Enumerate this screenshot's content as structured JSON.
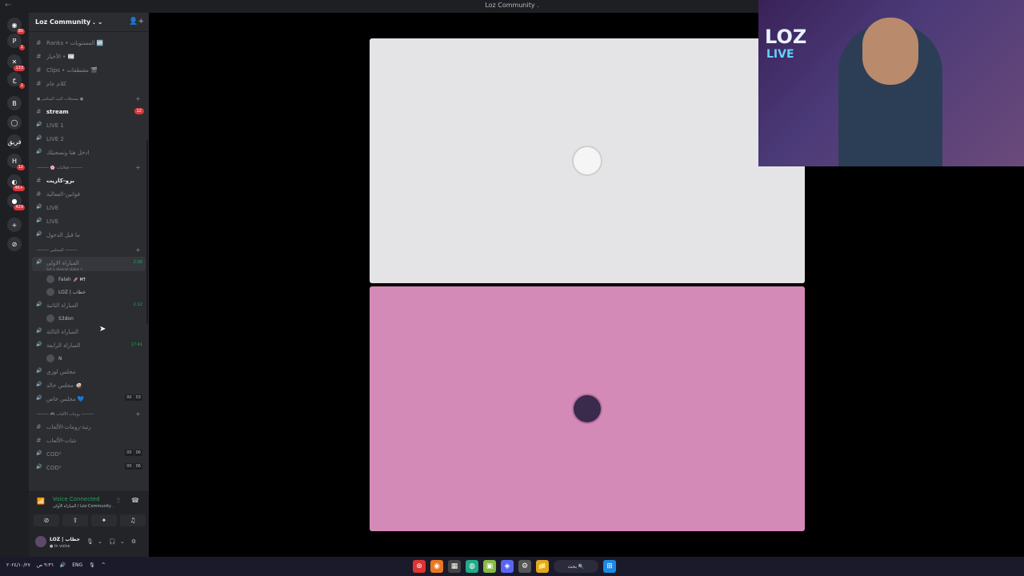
{
  "window": {
    "title": "Loz Community .",
    "back_icon": "arrow-left-icon"
  },
  "servers": [
    {
      "icon": "discord-icon",
      "glyph": "◉",
      "badge": "80"
    },
    {
      "icon": "server-p",
      "glyph": "P",
      "badge": "1"
    },
    {
      "icon": "server-b",
      "glyph": "✕",
      "badge": "133"
    },
    {
      "icon": "server-arabic",
      "glyph": "ج",
      "badge": "1"
    },
    {
      "icon": "server-blue",
      "glyph": "B",
      "badge": ""
    },
    {
      "icon": "server-ring",
      "glyph": "◯",
      "badge": ""
    },
    {
      "icon": "server-text",
      "glyph": "فريق",
      "badge": ""
    },
    {
      "icon": "server-h",
      "glyph": "H",
      "badge": "12"
    },
    {
      "icon": "server-c",
      "glyph": "◐",
      "badge": "4K+"
    },
    {
      "icon": "server-green",
      "glyph": "●",
      "badge": "429"
    },
    {
      "icon": "add-server",
      "glyph": "+",
      "badge": ""
    },
    {
      "icon": "explore",
      "glyph": "⊘",
      "badge": ""
    }
  ],
  "guild": {
    "name": "Loz Community .",
    "chevron": "⌄",
    "add_member_icon": "👤+"
  },
  "channels": [
    {
      "type": "text",
      "name": "Ranks • المستويات 🆙"
    },
    {
      "type": "text",
      "name": "الأخبار • 📰"
    },
    {
      "type": "text",
      "name": "Clips • مقتطفات 🎬"
    },
    {
      "type": "text",
      "name": "كلام عام"
    }
  ],
  "category1": {
    "name": "● مسجلات البث المباشر ●"
  },
  "channels2": [
    {
      "type": "text",
      "name": "stream",
      "active": true,
      "count": "12"
    },
    {
      "type": "voice",
      "name": "LIVE 1"
    },
    {
      "type": "voice",
      "name": "LIVE 2"
    },
    {
      "type": "voice",
      "name": "ادخل هنا وتسجيلك"
    }
  ],
  "category2": {
    "name": "───── 🌸 فعاليات ─────"
  },
  "channels3": [
    {
      "type": "text",
      "name": "برو-كاريت",
      "active": true
    },
    {
      "type": "text",
      "name": "قوانين-الفعالية"
    },
    {
      "type": "voice",
      "name": "LIVE"
    },
    {
      "type": "voice",
      "name": "LIVE"
    },
    {
      "type": "voice",
      "name": "ما قبل الدخول"
    }
  ],
  "category3": {
    "name": "───── المجلس ─────"
  },
  "voice_rooms": [
    {
      "name": "المباراة الاولى",
      "time": "2:36",
      "status": "Set a channel status ✎",
      "users": [
        {
          "name": "Falah",
          "tag": "🚀 MT"
        },
        {
          "name": "LOZ | خطاب",
          "tag": ""
        }
      ]
    },
    {
      "name": "المباراة الثانية",
      "time": "2:12",
      "users": [
        {
          "name": "S3don",
          "tag": ""
        }
      ]
    },
    {
      "name": "المباراة الثالثة",
      "time": "",
      "users": []
    },
    {
      "name": "المباراة الرابعة",
      "time": "17:41",
      "users": [
        {
          "name": "N",
          "tag": ""
        }
      ]
    }
  ],
  "channels4": [
    {
      "type": "voice",
      "name": "مجلس لوزي"
    },
    {
      "type": "voice",
      "name": "مجلس خالد 🥥"
    },
    {
      "type": "voice",
      "name": "مجلس خاص 💙",
      "pills": [
        "00",
        "03"
      ]
    }
  ],
  "category4": {
    "name": "───── 🎮 رومات الألعاب ─────"
  },
  "channels5": [
    {
      "type": "text",
      "name": "رتبة-رومات-الألعاب"
    },
    {
      "type": "text",
      "name": "شات-الألعاب"
    },
    {
      "type": "voice",
      "name": "COD¹",
      "pills": [
        "00",
        "06"
      ]
    },
    {
      "type": "voice",
      "name": "COD²",
      "pills": [
        "00",
        "06"
      ]
    }
  ],
  "voice_panel": {
    "title": "Voice Connected",
    "subtitle": "المباراة الأولى / Loz Community .",
    "buttons": [
      {
        "name": "camera-off-button",
        "glyph": "⊘"
      },
      {
        "name": "screen-share-button",
        "glyph": "⇪"
      },
      {
        "name": "activities-button",
        "glyph": "✦"
      },
      {
        "name": "soundboard-button",
        "glyph": "♫"
      }
    ]
  },
  "user_panel": {
    "name": "LOZ | خطاب",
    "status": "● In voice"
  },
  "stage": {
    "tile1_color": "#e4e4e6",
    "tile2_color": "#d48ab6"
  },
  "webcam": {
    "logo_line1": "LOZ",
    "logo_line2": "LIVE"
  },
  "taskbar": {
    "left": [
      "٩:٣٦ ص",
      "٢٠٢٤/١٠/٢٧",
      "🔊",
      "ENG",
      "🎙",
      "^"
    ],
    "search": "بحث 🔍",
    "apps": [
      "⊛",
      "◉",
      "▦",
      "◍",
      "▣",
      "◈",
      "⚙",
      "📁"
    ]
  }
}
